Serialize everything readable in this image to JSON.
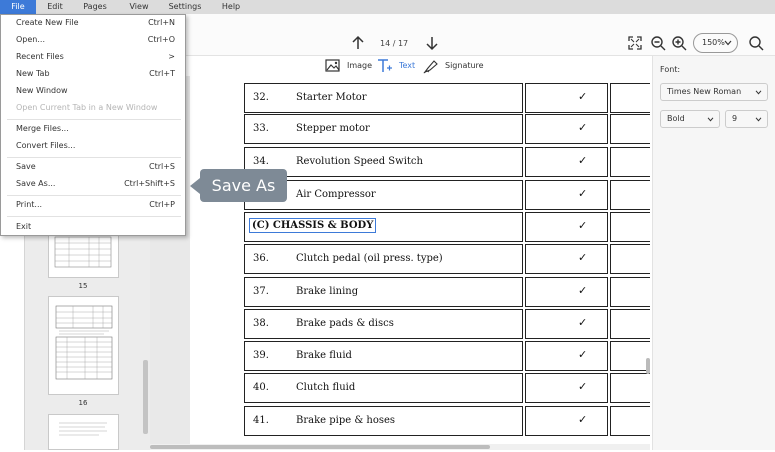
{
  "menubar": {
    "items": [
      "File",
      "Edit",
      "Pages",
      "View",
      "Settings",
      "Help"
    ]
  },
  "toolbar": {
    "page_indicator": "14 / 17",
    "zoom": "150%",
    "tools": [
      "Image",
      "Text",
      "Signature"
    ]
  },
  "right_panel": {
    "font_label": "Font:",
    "font_family": "Times New Roman",
    "font_weight": "Bold",
    "font_size": "9"
  },
  "file_menu": {
    "items": [
      {
        "label": "Create New File",
        "shortcut": "Ctrl+N"
      },
      {
        "label": "Open...",
        "shortcut": "Ctrl+O"
      },
      {
        "label": "Recent Files",
        "shortcut": ">"
      },
      {
        "label": "New Tab",
        "shortcut": "Ctrl+T"
      },
      {
        "label": "New Window",
        "shortcut": ""
      },
      {
        "label": "Open Current Tab in a New Window",
        "shortcut": ""
      },
      {
        "label": "Merge Files...",
        "shortcut": ""
      },
      {
        "label": "Convert Files...",
        "shortcut": ""
      },
      {
        "label": "Save",
        "shortcut": "Ctrl+S"
      },
      {
        "label": "Save As...",
        "shortcut": "Ctrl+Shift+S"
      },
      {
        "label": "Print...",
        "shortcut": "Ctrl+P"
      },
      {
        "label": "Exit",
        "shortcut": ""
      }
    ]
  },
  "tooltip": "Save As",
  "thumbnails": {
    "labels": [
      "15",
      "16"
    ]
  },
  "document": {
    "check_mark": "✓",
    "rows": [
      {
        "num": "32.",
        "desc": "Starter Motor"
      },
      {
        "num": "33.",
        "desc": "Stepper motor"
      },
      {
        "num": "34.",
        "desc": "Revolution Speed Switch"
      },
      {
        "num": "",
        "desc": "Air Compressor"
      },
      {
        "num": "",
        "desc": "(C) CHASSIS & BODY"
      },
      {
        "num": "36.",
        "desc": "Clutch pedal (oil press. type)"
      },
      {
        "num": "37.",
        "desc": "Brake lining"
      },
      {
        "num": "38.",
        "desc": "Brake pads & discs"
      },
      {
        "num": "39.",
        "desc": "Brake fluid"
      },
      {
        "num": "40.",
        "desc": "Clutch fluid"
      },
      {
        "num": "41.",
        "desc": "Brake pipe & hoses"
      }
    ]
  }
}
